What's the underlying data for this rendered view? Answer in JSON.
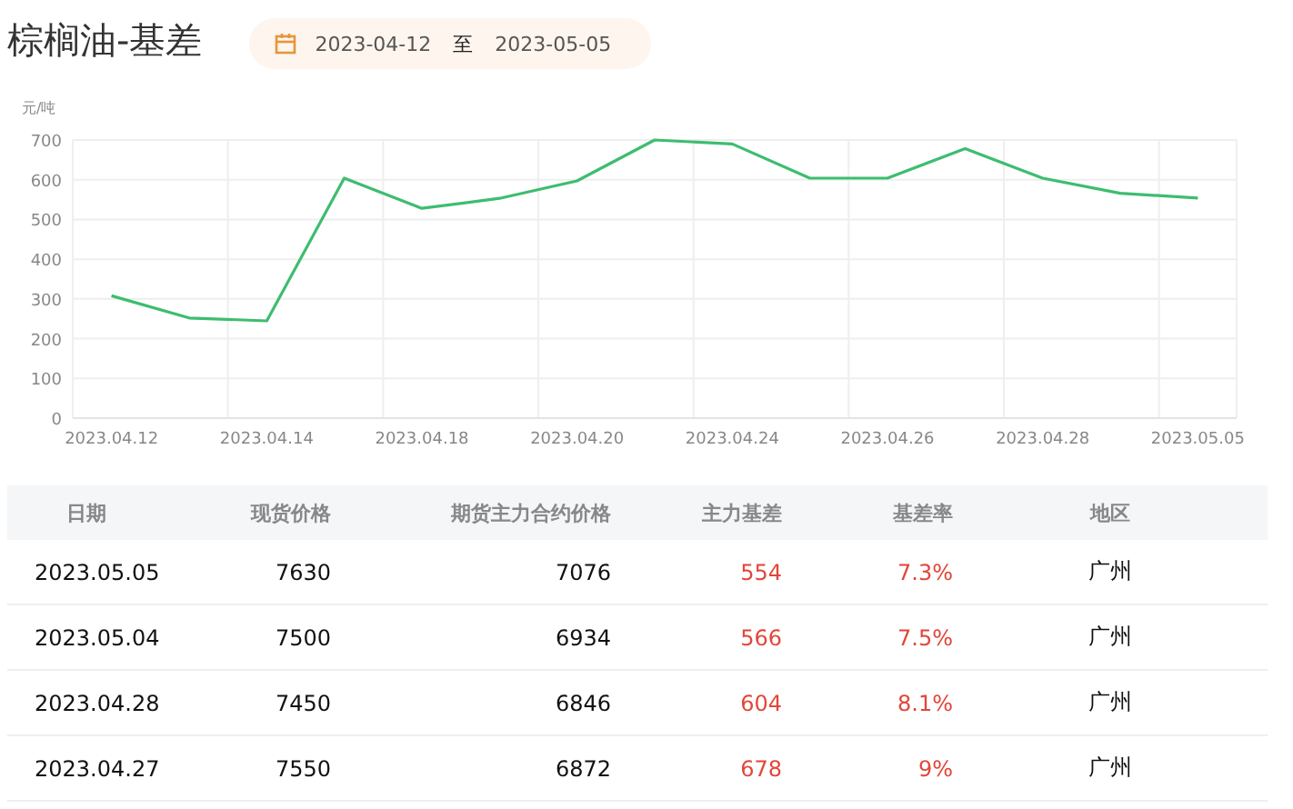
{
  "title": "棕榈油-基差",
  "date_range": {
    "start": "2023-04-12",
    "separator": "至",
    "end": "2023-05-05"
  },
  "chart": {
    "chart_data": {
      "type": "line",
      "ylabel": "元/吨",
      "categories": [
        "2023.04.12",
        null,
        "2023.04.14",
        null,
        "2023.04.18",
        null,
        "2023.04.20",
        null,
        "2023.04.24",
        null,
        "2023.04.26",
        null,
        "2023.04.28",
        null,
        "2023.05.05"
      ],
      "grid": true,
      "ylim": [
        0,
        700
      ],
      "yticks": [
        0,
        100,
        200,
        300,
        400,
        500,
        600,
        700
      ],
      "series": [
        {
          "color": "#3dbd6f",
          "values": [
            308,
            252,
            245,
            604,
            528,
            553,
            597,
            700,
            690,
            604,
            604,
            678,
            604,
            566,
            554
          ]
        }
      ]
    }
  },
  "table": {
    "columns": [
      "日期",
      "现货价格",
      "期货主力合约价格",
      "主力基差",
      "基差率",
      "地区"
    ],
    "rows": [
      [
        "2023.05.05",
        "7630",
        "7076",
        "554",
        "7.3%",
        "广州"
      ],
      [
        "2023.05.04",
        "7500",
        "6934",
        "566",
        "7.5%",
        "广州"
      ],
      [
        "2023.04.28",
        "7450",
        "6846",
        "604",
        "8.1%",
        "广州"
      ],
      [
        "2023.04.27",
        "7550",
        "6872",
        "678",
        "9%",
        "广州"
      ]
    ]
  }
}
